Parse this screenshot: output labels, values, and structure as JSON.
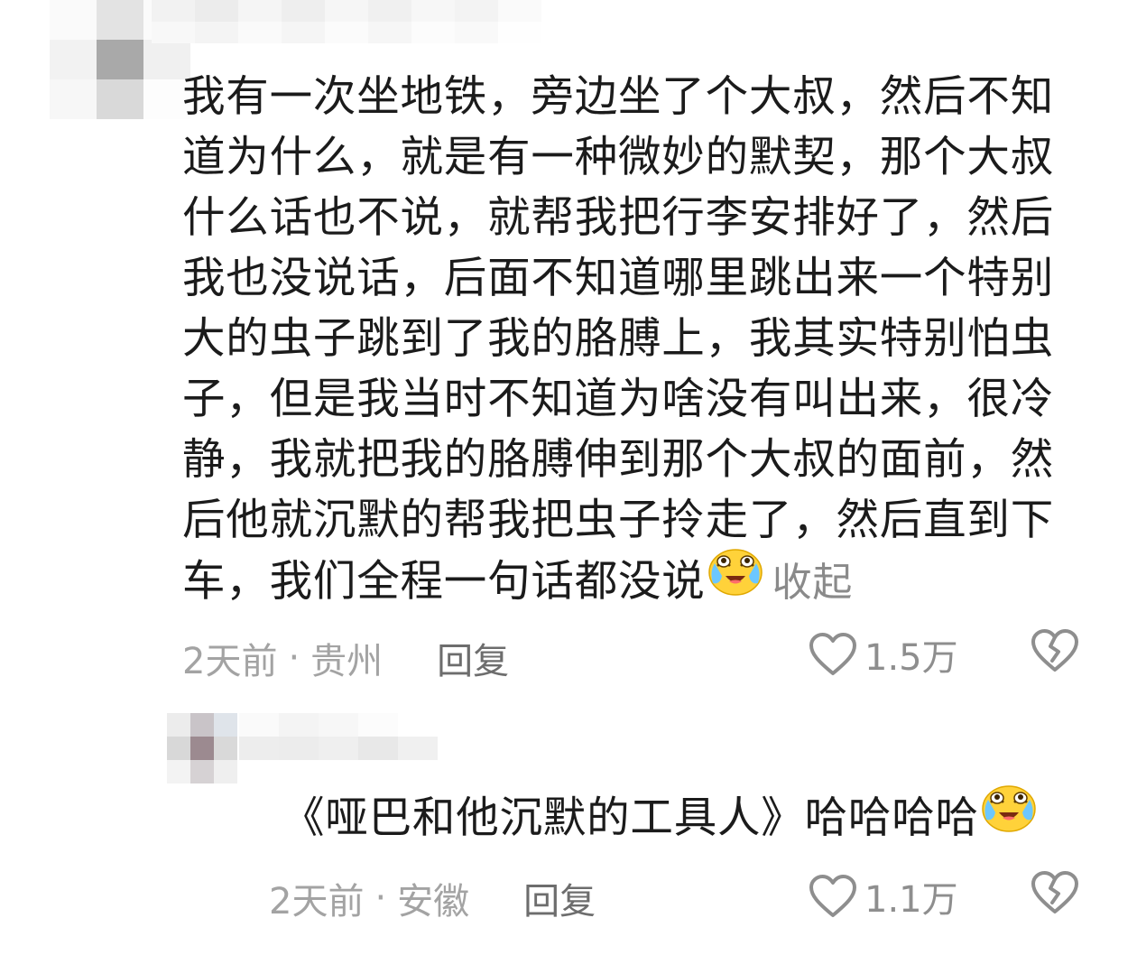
{
  "comments": [
    {
      "lines": [
        "我有一次坐地铁，旁边坐了个大叔，然后不知",
        "道为什么，就是有一种微妙的默契，那个大叔",
        "什么话也不说，就帮我把行李安排好了，然后",
        "我也没说话，后面不知道哪里跳出来一个特别",
        "大的虫子跳到了我的胳膊上，我其实特别怕虫",
        "子，但是我当时不知道为啥没有叫出来，很冷",
        "静，我就把我的胳膊伸到那个大叔的面前，然",
        "后他就沉默的帮我把虫子拎走了，然后直到下",
        "车，我们全程一句话都没说"
      ],
      "emoji": "laugh-cry-emoji",
      "collapse_label": "收起",
      "time": "2天前",
      "location": "贵州",
      "separator": "·",
      "reply_label": "回复",
      "likes": "1.5万"
    },
    {
      "text": "《哑巴和他沉默的工具人》哈哈哈哈",
      "emoji": "laugh-cry-emoji",
      "time": "2天前",
      "location": "安徽",
      "separator": "·",
      "reply_label": "回复",
      "likes": "1.1万"
    }
  ],
  "colors": {
    "text": "#1b1b1b",
    "meta": "#a3a3a3",
    "reply": "#6d6d6d",
    "icon": "#8e8e8e",
    "collapse": "#8a8a8a"
  }
}
